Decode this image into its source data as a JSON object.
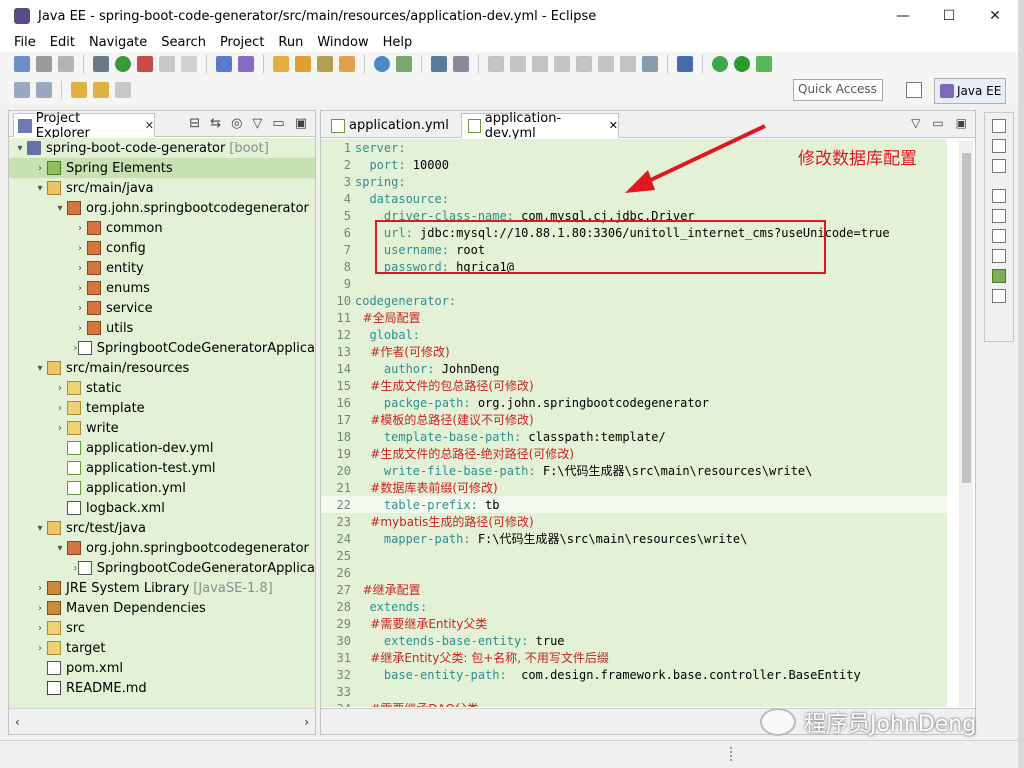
{
  "window": {
    "title": "Java EE - spring-boot-code-generator/src/main/resources/application-dev.yml - Eclipse",
    "minimize": "—",
    "maximize": "☐",
    "close": "✕"
  },
  "menu": [
    "File",
    "Edit",
    "Navigate",
    "Search",
    "Project",
    "Run",
    "Window",
    "Help"
  ],
  "toolbar": {
    "quick_access_placeholder": "Quick Access",
    "perspective_label": "Java EE"
  },
  "explorer": {
    "tab_label": "Project Explorer",
    "tab_close": "✕",
    "tree": [
      {
        "label": "spring-boot-code-generator",
        "suffix": "[boot]"
      },
      {
        "label": "Spring Elements"
      },
      {
        "label": "src/main/java"
      },
      {
        "label": "org.john.springbootcodegenerator"
      },
      {
        "label": "common"
      },
      {
        "label": "config"
      },
      {
        "label": "entity"
      },
      {
        "label": "enums"
      },
      {
        "label": "service"
      },
      {
        "label": "utils"
      },
      {
        "label": "SpringbootCodeGeneratorApplica"
      },
      {
        "label": "src/main/resources"
      },
      {
        "label": "static"
      },
      {
        "label": "template"
      },
      {
        "label": "write"
      },
      {
        "label": "application-dev.yml"
      },
      {
        "label": "application-test.yml"
      },
      {
        "label": "application.yml"
      },
      {
        "label": "logback.xml"
      },
      {
        "label": "src/test/java"
      },
      {
        "label": "org.john.springbootcodegenerator"
      },
      {
        "label": "SpringbootCodeGeneratorApplica"
      },
      {
        "label": "JRE System Library",
        "suffix": "[JavaSE-1.8]"
      },
      {
        "label": "Maven Dependencies"
      },
      {
        "label": "src"
      },
      {
        "label": "target"
      },
      {
        "label": "pom.xml"
      },
      {
        "label": "README.md"
      }
    ]
  },
  "editor": {
    "tabs": [
      {
        "label": "application.yml"
      },
      {
        "label": "application-dev.yml",
        "close": "✕"
      }
    ],
    "lines": [
      {
        "n": "1",
        "key": "server:",
        "val": "",
        "comment": ""
      },
      {
        "n": "2",
        "key": "  port:",
        "val": " 10000",
        "comment": ""
      },
      {
        "n": "3",
        "key": "spring:",
        "val": "",
        "comment": ""
      },
      {
        "n": "4",
        "key": "  datasource:",
        "val": "",
        "comment": ""
      },
      {
        "n": "5",
        "key": "    driver-class-name:",
        "val": " com.mysql.cj.jdbc.Driver",
        "comment": ""
      },
      {
        "n": "6",
        "key": "    url:",
        "val": " jdbc:mysql://10.88.1.80:3306/unitoll_internet_cms?useUnicode=true",
        "comment": ""
      },
      {
        "n": "7",
        "key": "    username:",
        "val": " root",
        "comment": ""
      },
      {
        "n": "8",
        "key": "    password:",
        "val": " hgrica1@",
        "comment": ""
      },
      {
        "n": "9",
        "key": "",
        "val": "",
        "comment": ""
      },
      {
        "n": "10",
        "key": "codegenerator:",
        "val": "",
        "comment": ""
      },
      {
        "n": "11",
        "key": "",
        "val": "",
        "comment": "  #全局配置"
      },
      {
        "n": "12",
        "key": "  global:",
        "val": "",
        "comment": ""
      },
      {
        "n": "13",
        "key": "",
        "val": "",
        "comment": "    #作者(可修改)"
      },
      {
        "n": "14",
        "key": "    author:",
        "val": " JohnDeng",
        "comment": ""
      },
      {
        "n": "15",
        "key": "",
        "val": "",
        "comment": "    #生成文件的包总路径(可修改)"
      },
      {
        "n": "16",
        "key": "    packge-path:",
        "val": " org.john.springbootcodegenerator",
        "comment": ""
      },
      {
        "n": "17",
        "key": "",
        "val": "",
        "comment": "    #模板的总路径(建议不可修改)"
      },
      {
        "n": "18",
        "key": "    template-base-path:",
        "val": " classpath:template/",
        "comment": ""
      },
      {
        "n": "19",
        "key": "",
        "val": "",
        "comment": "    #生成文件的总路径-绝对路径(可修改)"
      },
      {
        "n": "20",
        "key": "    write-file-base-path:",
        "val": " F:\\代码生成器\\src\\main\\resources\\write\\",
        "comment": ""
      },
      {
        "n": "21",
        "key": "",
        "val": "",
        "comment": "    #数据库表前缀(可修改)"
      },
      {
        "n": "22",
        "key": "    table-prefix:",
        "val": " tb",
        "comment": ""
      },
      {
        "n": "23",
        "key": "",
        "val": "",
        "comment": "    #mybatis生成的路径(可修改)"
      },
      {
        "n": "24",
        "key": "    mapper-path:",
        "val": " F:\\代码生成器\\src\\main\\resources\\write\\",
        "comment": ""
      },
      {
        "n": "25",
        "key": "",
        "val": "",
        "comment": ""
      },
      {
        "n": "26",
        "key": "",
        "val": "",
        "comment": ""
      },
      {
        "n": "27",
        "key": "",
        "val": "",
        "comment": "  #继承配置"
      },
      {
        "n": "28",
        "key": "  extends:",
        "val": "",
        "comment": ""
      },
      {
        "n": "29",
        "key": "",
        "val": "",
        "comment": "    #需要继承Entity父类"
      },
      {
        "n": "30",
        "key": "    extends-base-entity:",
        "val": " true",
        "comment": ""
      },
      {
        "n": "31",
        "key": "",
        "val": "",
        "comment": "    #继承Entity父类: 包+名称, 不用写文件后缀"
      },
      {
        "n": "32",
        "key": "    base-entity-path:",
        "val": "  com.design.framework.base.controller.BaseEntity",
        "comment": ""
      },
      {
        "n": "33",
        "key": "",
        "val": "",
        "comment": ""
      },
      {
        "n": "34",
        "key": "",
        "val": "",
        "comment": "    #需要继承DAO父类"
      }
    ]
  },
  "annotation": {
    "text": "修改数据库配置",
    "color": "#e0171e"
  },
  "watermark": {
    "text": "程序员JohnDeng"
  },
  "colors": {
    "editor_bg": "#e3f2d6",
    "key": "#2f8f8f",
    "comment": "#cc2222",
    "accent": "#e0171e"
  }
}
